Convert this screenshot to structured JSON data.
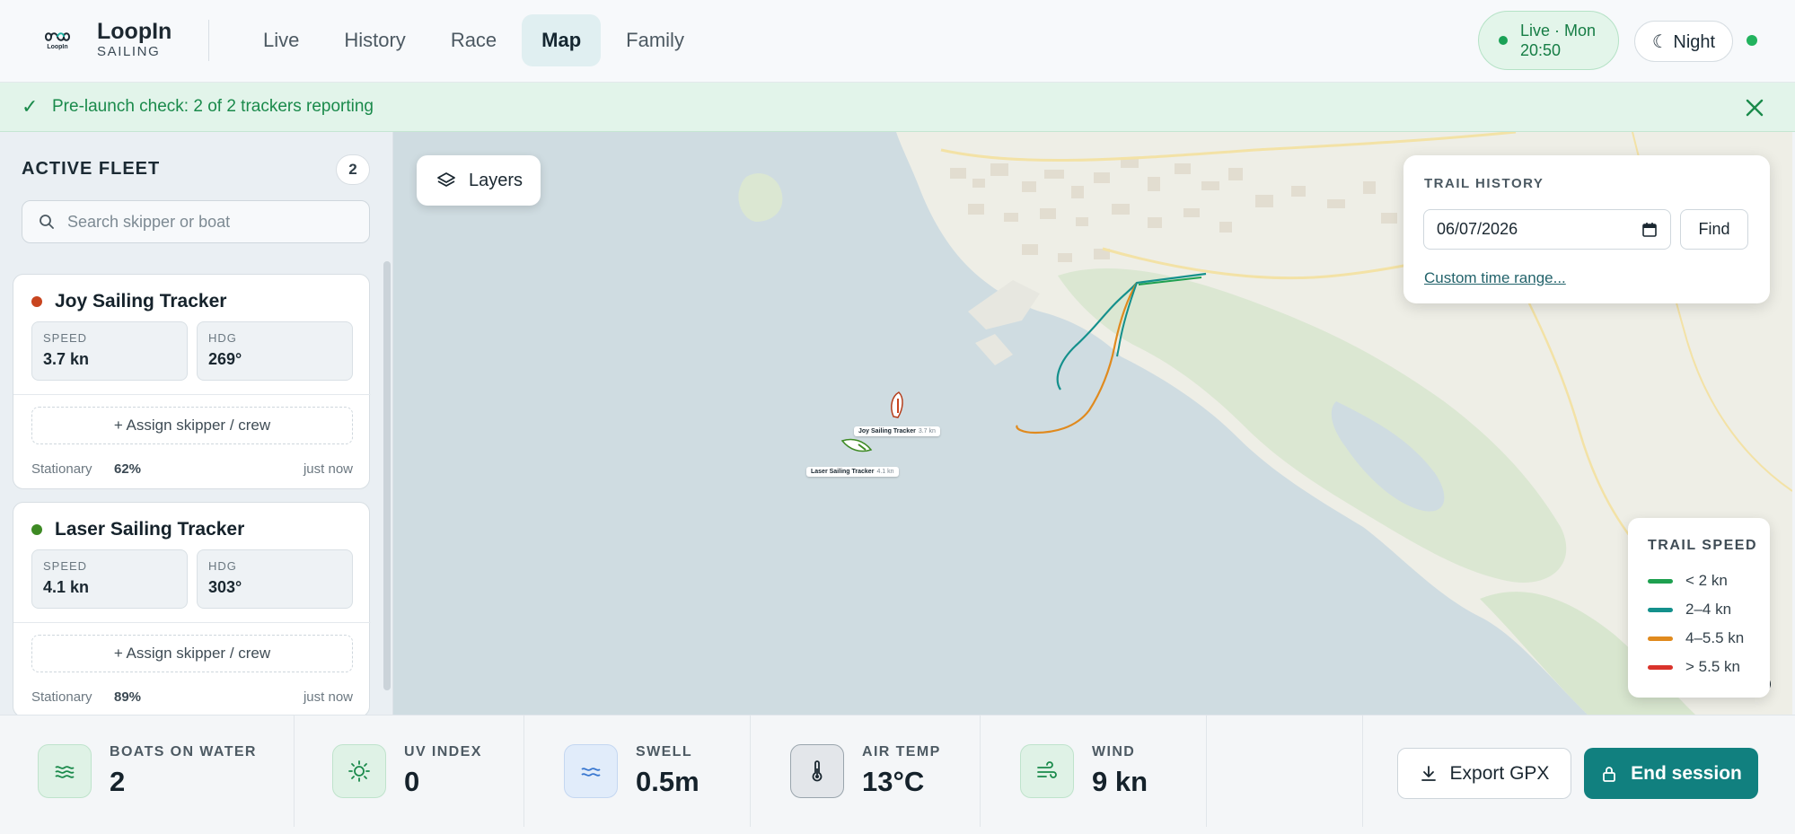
{
  "app": {
    "name": "LoopIn",
    "subtitle": "SAILING",
    "logo_text": "LoopIn"
  },
  "nav": {
    "tabs": [
      {
        "label": "Live"
      },
      {
        "label": "History"
      },
      {
        "label": "Race"
      },
      {
        "label": "Map",
        "active": true
      },
      {
        "label": "Family"
      }
    ]
  },
  "header": {
    "live_status": "Live · Mon 20:50",
    "night_toggle": "☾ Night",
    "connection_color": "#22b35e"
  },
  "banner": {
    "icon": "check-icon",
    "text": "Pre-launch check: 2 of 2 trackers reporting"
  },
  "sidebar": {
    "title": "ACTIVE FLEET",
    "count": "2",
    "search_placeholder": "Search skipper or boat",
    "boats": [
      {
        "name": "Joy Sailing Tracker",
        "color": "#c8451f",
        "speed_label": "SPEED",
        "speed": "3.7 kn",
        "hdg_label": "HDG",
        "hdg": "269°",
        "assign_label": "+ Assign skipper / crew",
        "status": "Stationary",
        "stationary_pct": "62%",
        "updated": "just now"
      },
      {
        "name": "Laser Sailing Tracker",
        "color": "#3e8a24",
        "speed_label": "SPEED",
        "speed": "4.1 kn",
        "hdg_label": "HDG",
        "hdg": "303°",
        "assign_label": "+ Assign skipper / crew",
        "status": "Stationary",
        "stationary_pct": "89%",
        "updated": "just now"
      }
    ]
  },
  "map": {
    "layers_label": "Layers",
    "trail_history": {
      "title": "TRAIL HISTORY",
      "date": "06/07/2026",
      "find_label": "Find",
      "custom_range_label": "Custom time range..."
    },
    "legend": {
      "title": "TRAIL SPEED",
      "items": [
        {
          "label": "< 2 kn",
          "color": "#1ea050"
        },
        {
          "label": "2–4 kn",
          "color": "#14908c"
        },
        {
          "label": "4–5.5 kn",
          "color": "#e08a1e"
        },
        {
          "label": "> 5.5 kn",
          "color": "#d9332b"
        }
      ]
    },
    "boat_labels": [
      {
        "name": "Joy Sailing Tracker",
        "speed": "3.7 kn"
      },
      {
        "name": "Laser Sailing Tracker",
        "speed": "4.1 kn"
      }
    ]
  },
  "metrics": [
    {
      "label": "BOATS ON WATER",
      "value": "2",
      "icon": "waves-icon"
    },
    {
      "label": "UV INDEX",
      "value": "0",
      "icon": "sun-icon"
    },
    {
      "label": "SWELL",
      "value": "0.5m",
      "icon": "swell-icon"
    },
    {
      "label": "AIR TEMP",
      "value": "13°C",
      "icon": "thermometer-icon"
    },
    {
      "label": "WIND",
      "value": "9 kn",
      "icon": "wind-icon"
    }
  ],
  "actions": {
    "export_label": "Export GPX",
    "end_label": "End session"
  }
}
